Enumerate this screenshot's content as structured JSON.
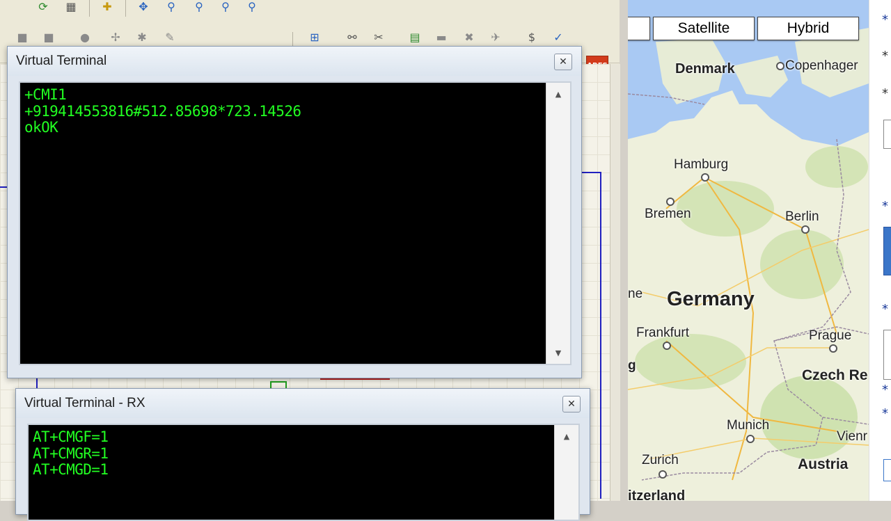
{
  "isis": {
    "ares_label": "ARES"
  },
  "terminal_main": {
    "title": "Virtual Terminal",
    "close_glyph": "✕",
    "lines": [
      "+CMI1",
      "+919414553816#512.85698*723.14526",
      "okOK"
    ],
    "scroll_up": "▲",
    "scroll_down": "▼"
  },
  "terminal_rx": {
    "title": "Virtual Terminal - RX",
    "close_glyph": "✕",
    "lines": [
      "AT+CMGF=1",
      "AT+CMGR=1",
      "AT+CMGD=1"
    ],
    "scroll_up": "▲"
  },
  "map": {
    "buttons": {
      "satellite": "Satellite",
      "hybrid": "Hybrid"
    },
    "countries": {
      "denmark": "Denmark",
      "germany": "Germany",
      "czech": "Czech Re",
      "austria": "Austria",
      "switzerland": "itzerland"
    },
    "cities": {
      "copenhagen": "Copenhager",
      "hamburg": "Hamburg",
      "bremen": "Bremen",
      "berlin": "Berlin",
      "frankfurt": "Frankfurt",
      "prague": "Prague",
      "munich": "Munich",
      "vienna": "Vienr",
      "zurich": "Zurich",
      "ne_fragment": "ne",
      "g_fragment": "g"
    }
  },
  "right_strip": {
    "star": "*"
  },
  "colors": {
    "terminal_text": "#22ff22",
    "terminal_bg": "#000000",
    "sea": "#a9c9f3",
    "land": "#eef0dc",
    "forest": "#cfe2b0"
  }
}
